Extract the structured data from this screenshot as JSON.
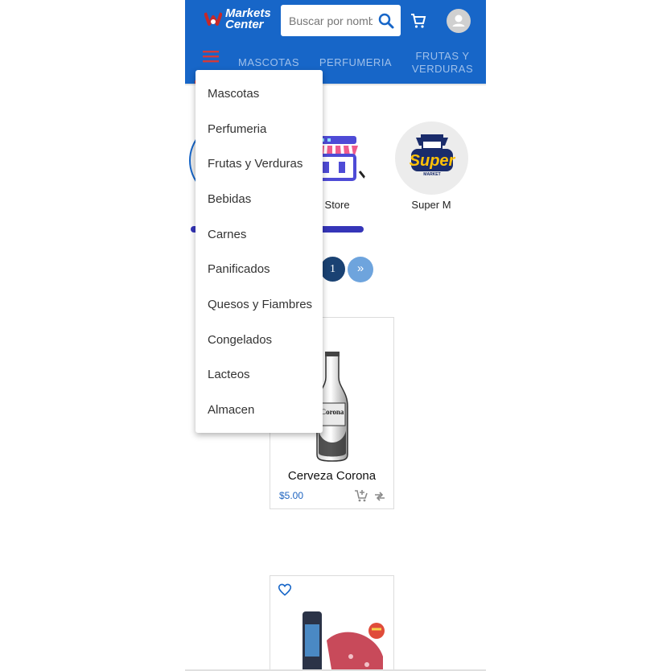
{
  "header": {
    "logo_text_1": "Markets",
    "logo_text_2": "Center",
    "search_placeholder": "Buscar por nombre",
    "icons": [
      "search-icon",
      "shopping-cart-icon",
      "account-icon",
      "menu-icon"
    ],
    "colors": {
      "primary": "#1766c8",
      "accent": "#d23b3b"
    }
  },
  "nav": {
    "tabs": [
      {
        "label": "MASCOTAS"
      },
      {
        "label": "PERFUMERIA"
      },
      {
        "label": "FRUTAS Y VERDURAS"
      }
    ]
  },
  "stores": [
    {
      "name": "J Store"
    },
    {
      "name": "Super M",
      "logo_text": "Super",
      "logo_subtext": "MARKET"
    }
  ],
  "pagination": {
    "current": "1",
    "next": "»"
  },
  "products": [
    {
      "name": "Cerveza Corona",
      "price": "$5.00",
      "label_text": "Corona"
    },
    {
      "name": ""
    }
  ],
  "dropdown": {
    "items": [
      "Mascotas",
      "Perfumeria",
      "Frutas y Verduras",
      "Bebidas",
      "Carnes",
      "Panificados",
      "Quesos y Fiambres",
      "Congelados",
      "Lacteos",
      "Almacen"
    ]
  }
}
